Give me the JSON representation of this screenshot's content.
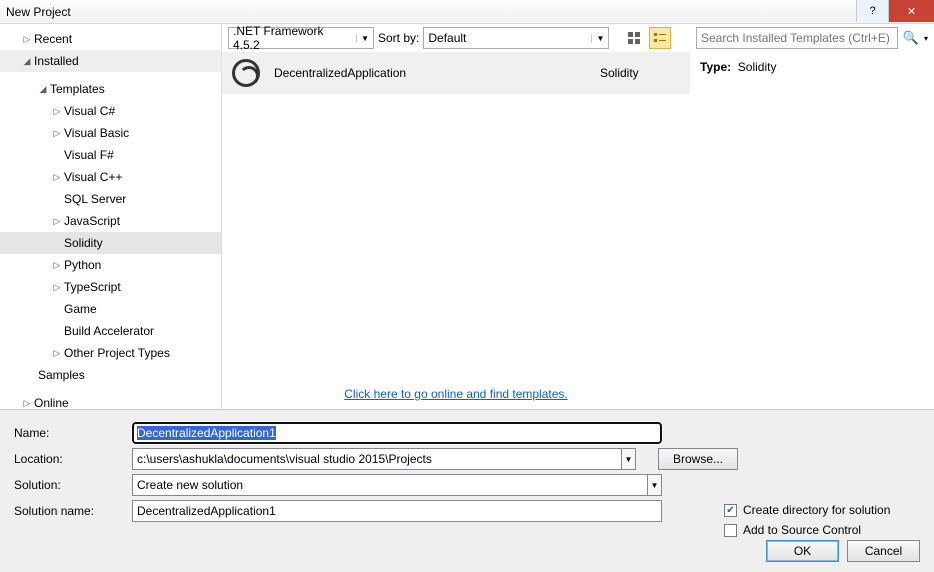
{
  "title": "New Project",
  "sidebar": {
    "recent": "Recent",
    "installed": "Installed",
    "templates": "Templates",
    "samples": "Samples",
    "online": "Online",
    "nodes": [
      {
        "label": "Visual C#",
        "arrow": true
      },
      {
        "label": "Visual Basic",
        "arrow": true
      },
      {
        "label": "Visual F#",
        "arrow": false
      },
      {
        "label": "Visual C++",
        "arrow": true
      },
      {
        "label": "SQL Server",
        "arrow": false
      },
      {
        "label": "JavaScript",
        "arrow": true
      },
      {
        "label": "Solidity",
        "arrow": false,
        "selected": true
      },
      {
        "label": "Python",
        "arrow": true
      },
      {
        "label": "TypeScript",
        "arrow": true
      },
      {
        "label": "Game",
        "arrow": false
      },
      {
        "label": "Build Accelerator",
        "arrow": false
      },
      {
        "label": "Other Project Types",
        "arrow": true
      }
    ]
  },
  "toolbar": {
    "framework": ".NET Framework 4.5.2",
    "sortby_label": "Sort by:",
    "sortby_value": "Default"
  },
  "template": {
    "name": "DecentralizedApplication",
    "lang": "Solidity"
  },
  "onlinelink": "Click here to go online and find templates.",
  "search": {
    "placeholder": "Search Installed Templates (Ctrl+E)"
  },
  "info": {
    "type_label": "Type:",
    "type_value": "Solidity"
  },
  "form": {
    "name_label": "Name:",
    "name_value": "DecentralizedApplication1",
    "location_label": "Location:",
    "location_value": "c:\\users\\ashukla\\documents\\visual studio 2015\\Projects",
    "solution_label": "Solution:",
    "solution_value": "Create new solution",
    "sln_name_label": "Solution name:",
    "sln_name_value": "DecentralizedApplication1",
    "browse": "Browse...",
    "chk_dir": "Create directory for solution",
    "chk_src": "Add to Source Control",
    "ok": "OK",
    "cancel": "Cancel"
  }
}
